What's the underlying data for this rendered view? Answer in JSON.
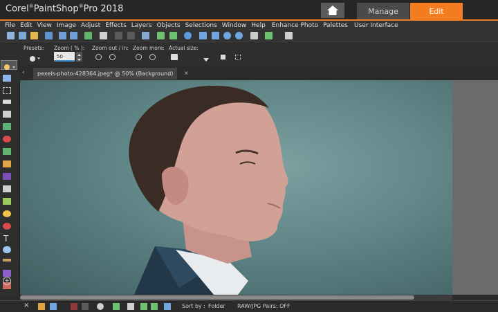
{
  "app": {
    "title": "Corel",
    "title_reg": "®",
    "title_main": "PaintShop",
    "title_reg2": "®",
    "title_rest": "Pro 2018"
  },
  "workspace_tabs": {
    "manage": "Manage",
    "edit": "Edit"
  },
  "colors": {
    "accent": "#f47c20"
  },
  "menu": [
    "File",
    "Edit",
    "View",
    "Image",
    "Adjust",
    "Effects",
    "Layers",
    "Objects",
    "Selections",
    "Window",
    "Help",
    "Enhance Photo",
    "Palettes",
    "User Interface"
  ],
  "tool_options": {
    "presets_label": "Presets:",
    "zoom_label": "Zoom ( % ):",
    "zoom_value": "50",
    "zoom_out_in_label": "Zoom out / in:",
    "zoom_more_label": "Zoom more:",
    "actual_size_label": "Actual size:"
  },
  "document_tab": {
    "title": "pexels-photo-428364.jpeg* @  50% (Background)",
    "close": "×"
  },
  "organizer": {
    "sort_by_label": "Sort by :",
    "sort_value": "Folder",
    "raw_pairs": "RAW/JPG Pairs: OFF",
    "close": "×"
  }
}
